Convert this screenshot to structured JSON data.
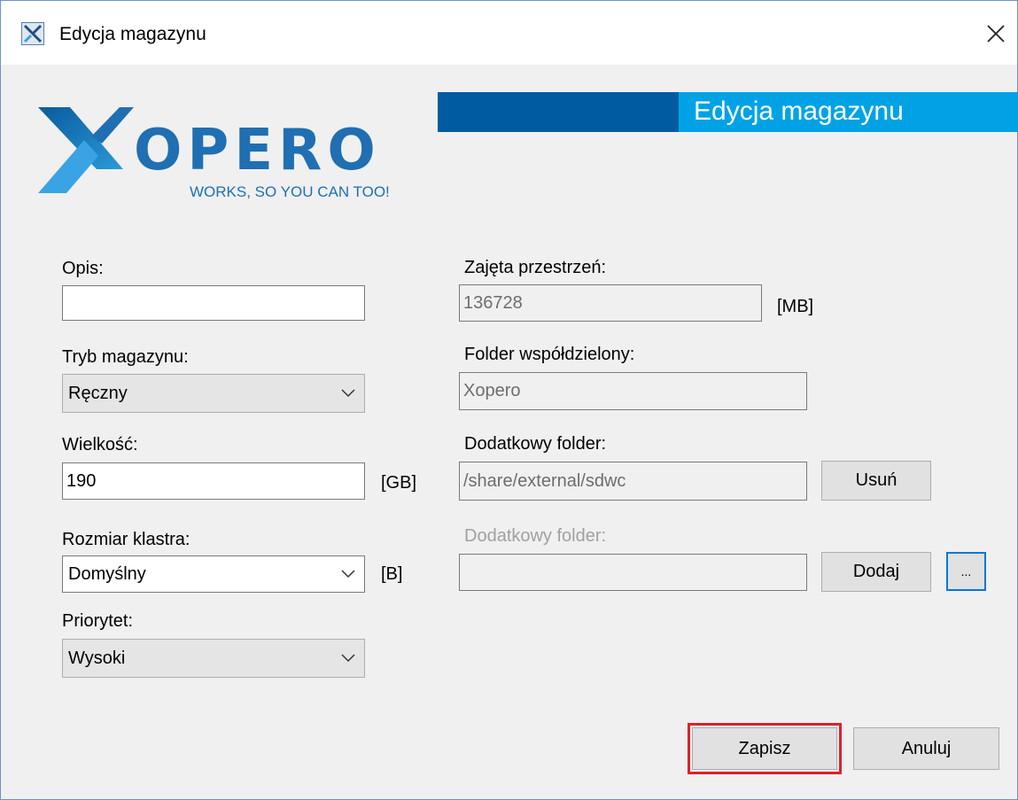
{
  "window": {
    "title": "Edycja magazynu"
  },
  "banner": {
    "title": "Edycja magazynu"
  },
  "logo": {
    "tagline": "WORKS, SO YOU CAN TOO!",
    "wordmark": "XOPERO"
  },
  "form": {
    "opis": {
      "label": "Opis:",
      "value": ""
    },
    "tryb": {
      "label": "Tryb magazynu:",
      "value": "Ręczny"
    },
    "wielkosc": {
      "label": "Wielkość:",
      "value": "190",
      "unit": "[GB]"
    },
    "klaster": {
      "label": "Rozmiar klastra:",
      "value": "Domyślny",
      "unit": "[B]"
    },
    "priorytet": {
      "label": "Priorytet:",
      "value": "Wysoki"
    },
    "zajeta": {
      "label": "Zajęta przestrzeń:",
      "value": "136728",
      "unit": "[MB]"
    },
    "folder_wsp": {
      "label": "Folder współdzielony:",
      "value": "Xopero"
    },
    "dodatkowy1": {
      "label": "Dodatkowy folder:",
      "value": "/share/external/sdwc",
      "button": "Usuń"
    },
    "dodatkowy2": {
      "label": "Dodatkowy folder:",
      "value": "",
      "button": "Dodaj",
      "browse": "..."
    }
  },
  "actions": {
    "save": "Zapisz",
    "cancel": "Anuluj"
  },
  "colors": {
    "banner_dark": "#005c9f",
    "banner_light": "#00a2e6",
    "logo_blue": "#1f6fb2",
    "highlight_red": "#e0202a"
  }
}
